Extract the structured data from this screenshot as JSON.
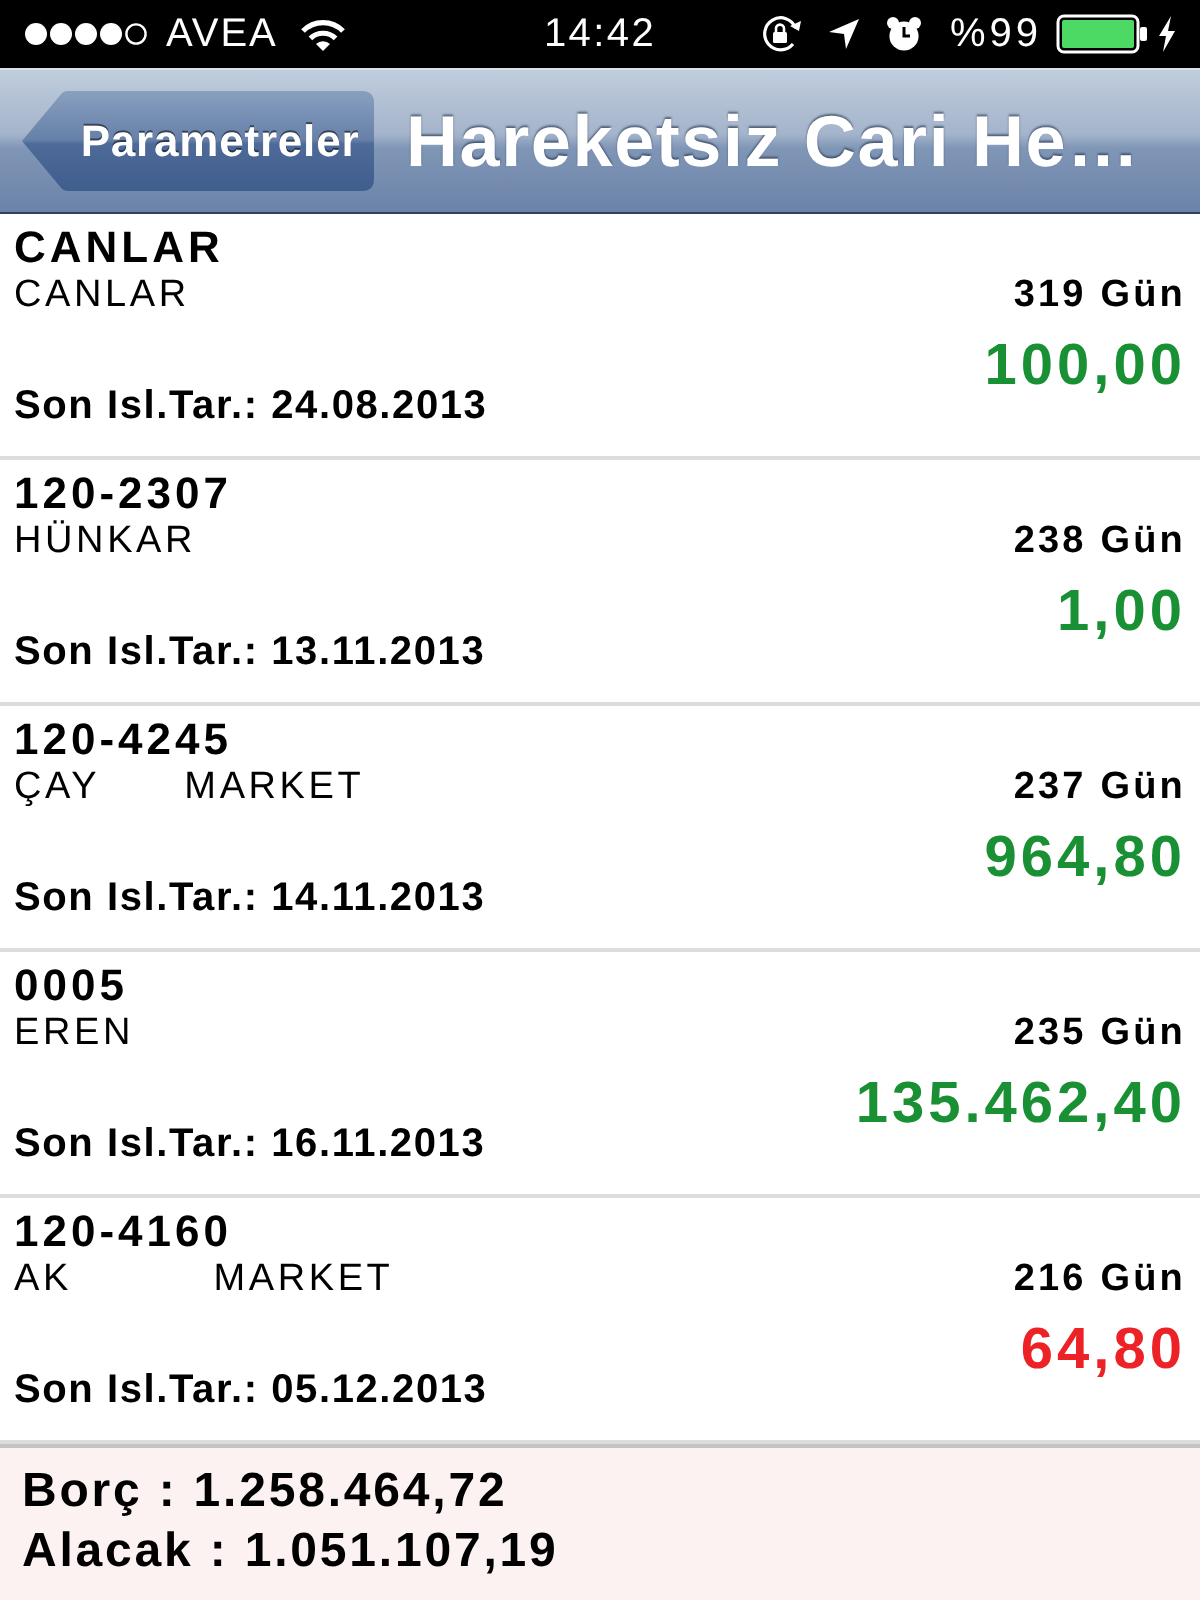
{
  "status_bar": {
    "carrier": "AVEA",
    "time": "14:42",
    "battery": "%99"
  },
  "nav_bar": {
    "back_button": "Parametreler",
    "title": "Hareketsiz Cari He…"
  },
  "rows": [
    {
      "code": "CANLAR",
      "name": "CANLAR",
      "days": "319 Gün",
      "amount": "100,00",
      "color": "#1a9034",
      "date": "Son Isl.Tar.: 24.08.2013"
    },
    {
      "code": "120-2307",
      "name": "HÜNKAR",
      "days": "238 Gün",
      "amount": "1,00",
      "color": "#1a9034",
      "date": "Son Isl.Tar.: 13.11.2013"
    },
    {
      "code": "120-4245",
      "name": "ÇAY      MARKET",
      "days": "237 Gün",
      "amount": "964,80",
      "color": "#1a9034",
      "date": "Son Isl.Tar.: 14.11.2013"
    },
    {
      "code": "0005",
      "name": "EREN",
      "days": "235 Gün",
      "amount": "135.462,40",
      "color": "#1a9034",
      "date": "Son Isl.Tar.: 16.11.2013"
    },
    {
      "code": "120-4160",
      "name": "AK          MARKET",
      "days": "216 Gün",
      "amount": "64,80",
      "color": "#ec2227",
      "date": "Son Isl.Tar.: 05.12.2013"
    }
  ],
  "totals": [
    "Borç : 1.258.464,72",
    "Alacak : 1.051.107,19"
  ]
}
